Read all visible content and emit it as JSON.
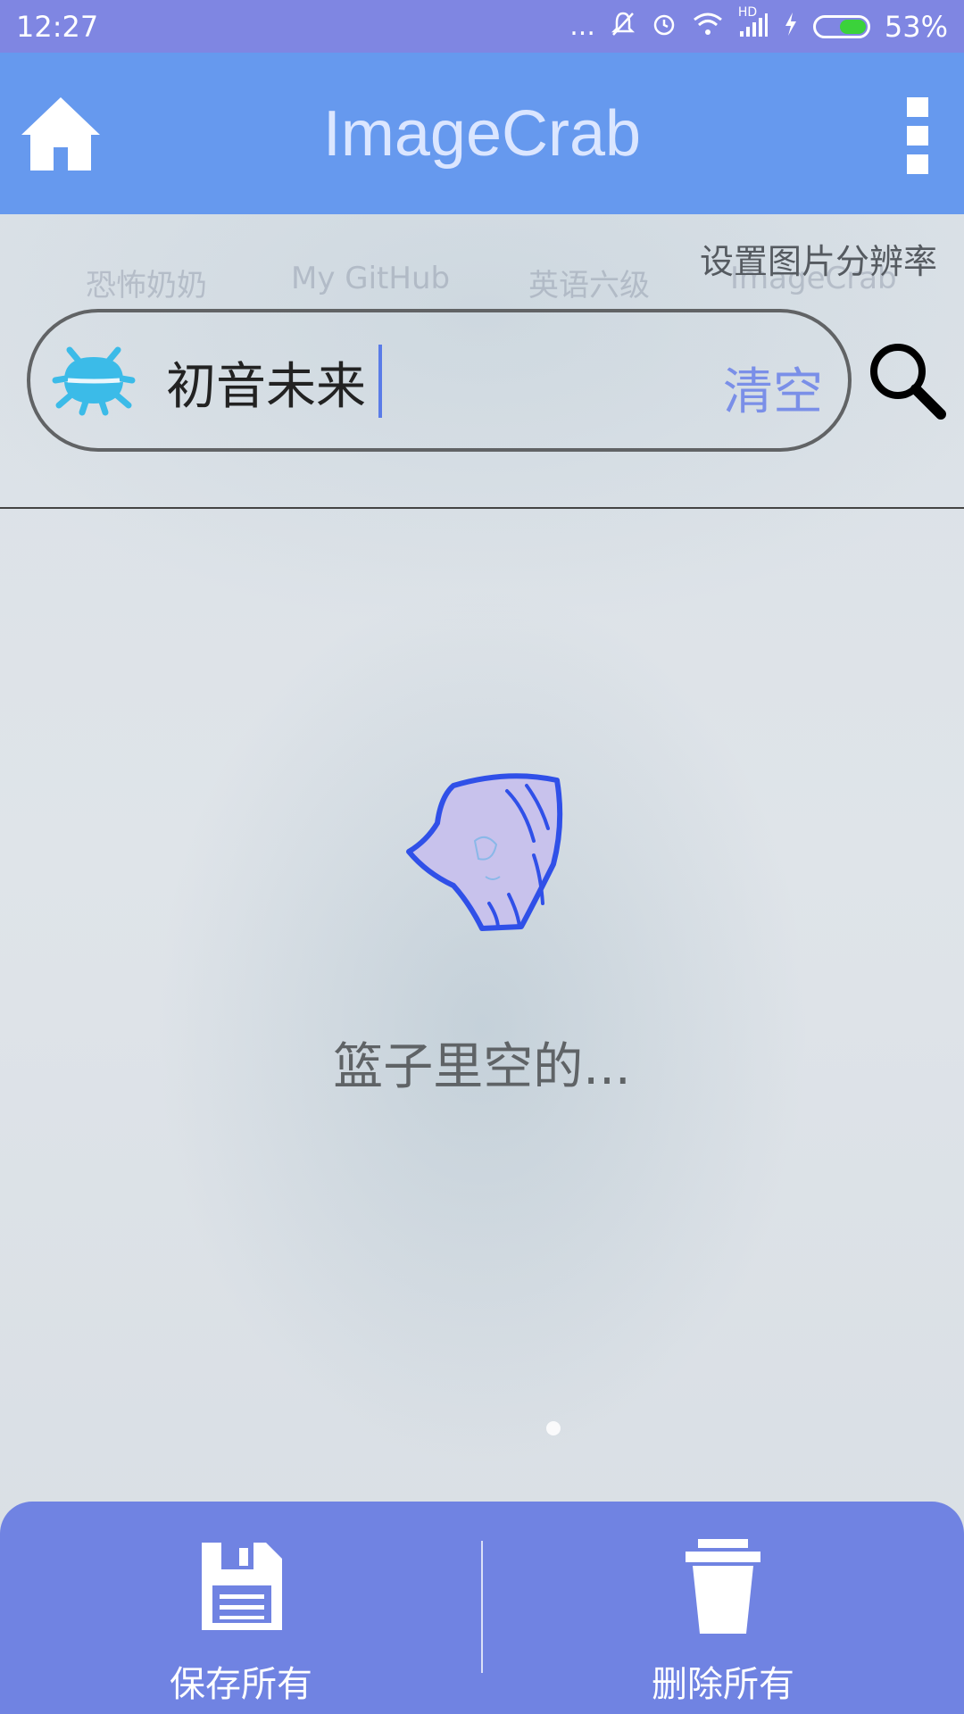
{
  "status_bar": {
    "time": "12:27",
    "more": "...",
    "network": "HD",
    "battery_percent": "53%",
    "battery_level": 0.53
  },
  "app_bar": {
    "title": "ImageCrab"
  },
  "resolution_link": "设置图片分辨率",
  "background_labels": [
    "恐怖奶奶",
    "My GitHub",
    "英语六级",
    "ImageCrab"
  ],
  "search": {
    "value": "初音未来",
    "clear_label": "清空"
  },
  "empty_state": {
    "message": "篮子里空的..."
  },
  "bottom_bar": {
    "save_label": "保存所有",
    "delete_label": "删除所有"
  },
  "colors": {
    "status_bar": "#7f86e2",
    "app_bar": "#6699ee",
    "bottom_bar": "#7083e2",
    "accent": "#7a8fe8"
  }
}
